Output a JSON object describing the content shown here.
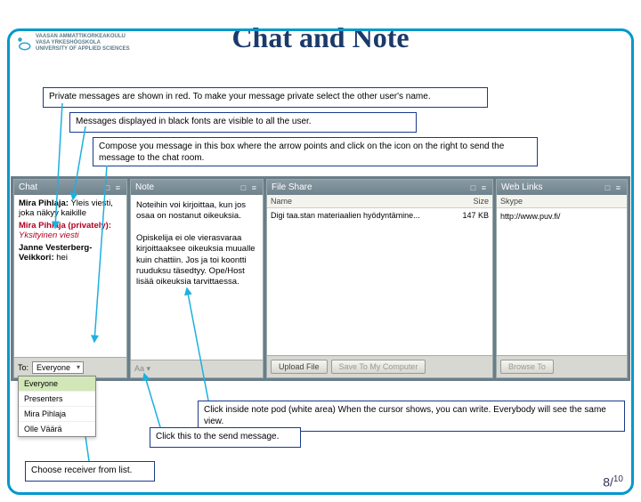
{
  "logo": {
    "line1": "VAASAN AMMATTIKORKEAKOULU",
    "line2": "VASA YRKESHÖGSKOLA",
    "line3": "UNIVERSITY OF APPLIED SCIENCES"
  },
  "title": "Chat and Note",
  "callouts": {
    "c1": "Private messages are shown in red. To make your message private select the other user's name.",
    "c2": "Messages displayed in black fonts are visible to all the user.",
    "c3": "Compose you message in this box where the arrow points and click on the icon on the right to send the message to the chat room.",
    "c4": "Click inside note pod (white area) When the cursor shows, you can write. Everybody will see the same view.",
    "c5": "Click this to the send message.",
    "c6": "Choose receiver from list."
  },
  "chat": {
    "title": "Chat",
    "messages": [
      {
        "name": "Mira Pihlaja:",
        "text": "Yleis viesti, joka näkyy kaikille",
        "private": false
      },
      {
        "name": "Mira Pihlaja (privately):",
        "text": "Yksityinen viesti",
        "private": true
      },
      {
        "name": "Janne Vesterberg-Veikkori:",
        "text": "hei",
        "private": false
      }
    ],
    "to_label": "To:",
    "selected": "Everyone",
    "options": [
      "Everyone",
      "Presenters",
      "Mira Pihlaja",
      "Olle Väärä"
    ]
  },
  "note": {
    "title": "Note",
    "body": "Noteihin voi kirjoittaa, kun jos osaa on nostanut oikeuksia.\n\nOpiskelija ei ole vierasvaraa kirjoittaaksee oikeuksia muualle kuin chattiin. Jos ja toi koontti ruuduksu täsedtyy. Ope/Host lisää oikeuksia tarvittaessa."
  },
  "fileshare": {
    "title": "File Share",
    "col_name": "Name",
    "col_size": "Size",
    "rows": [
      {
        "name": "Digi taa.stan materiaalien hyödyntämine...",
        "size": "147 KB"
      }
    ],
    "btn_upload": "Upload File",
    "btn_save": "Save To My Computer"
  },
  "weblinks": {
    "title": "Web Links",
    "list_header": "Skype",
    "item": "http://www.puv.fi/",
    "btn_browse": "Browse To"
  },
  "page": {
    "current": "8",
    "total": "10"
  }
}
